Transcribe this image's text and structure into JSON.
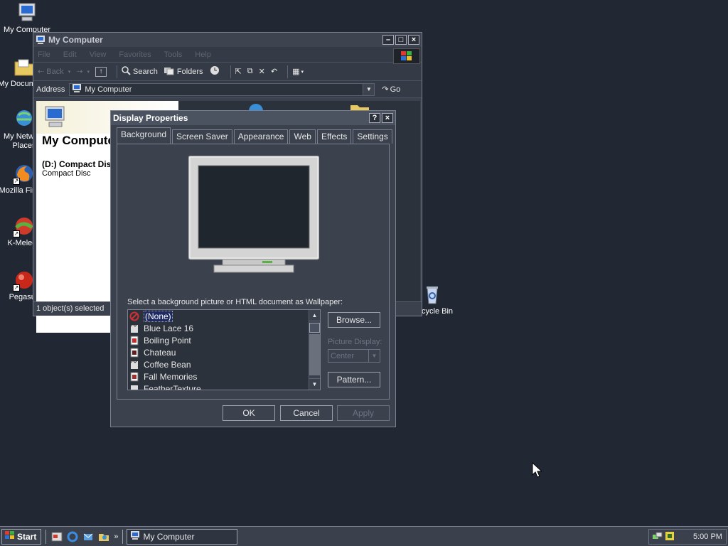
{
  "desktop": {
    "icons": [
      {
        "label": "My Computer",
        "icon": "computer-icon"
      },
      {
        "label": "My Documents",
        "icon": "folder-icon"
      },
      {
        "label": "My Network Places",
        "icon": "network-icon"
      },
      {
        "label": "Mozilla Firefox",
        "icon": "firefox-icon"
      },
      {
        "label": "K-Meleon",
        "icon": "kmeleon-icon"
      },
      {
        "label": "Pegasus",
        "icon": "pegasus-icon"
      },
      {
        "label": "Recycle Bin",
        "icon": "recycle-bin-icon"
      }
    ]
  },
  "mycomputer": {
    "title": "My Computer",
    "menu": [
      "File",
      "Edit",
      "View",
      "Favorites",
      "Tools",
      "Help"
    ],
    "toolbar": {
      "back": "Back",
      "search": "Search",
      "folders": "Folders"
    },
    "address_label": "Address",
    "address_value": "My Computer",
    "go_label": "Go",
    "panel_title": "My Computer",
    "drive_name": "(D:) Compact Disc",
    "drive_type": "Compact Disc",
    "status": "1 object(s) selected"
  },
  "dialog": {
    "title": "Display Properties",
    "help": "?",
    "close": "×",
    "tabs": [
      "Background",
      "Screen Saver",
      "Appearance",
      "Web",
      "Effects",
      "Settings"
    ],
    "active_tab": "Background",
    "wallpaper_label": "Select a background picture or HTML document as Wallpaper:",
    "wallpapers": [
      "(None)",
      "Blue Lace 16",
      "Boiling Point",
      "Chateau",
      "Coffee Bean",
      "Fall Memories",
      "FeatherTexture"
    ],
    "selected_wallpaper": "(None)",
    "browse": "Browse...",
    "picture_display_label": "Picture Display:",
    "picture_display_value": "Center",
    "pattern": "Pattern...",
    "ok": "OK",
    "cancel": "Cancel",
    "apply": "Apply"
  },
  "taskbar": {
    "start": "Start",
    "task": "My Computer",
    "clock": "5:00 PM"
  },
  "colors": {
    "desktop": "#222833",
    "window": "#3b424e",
    "selection": "#1f2a60"
  }
}
